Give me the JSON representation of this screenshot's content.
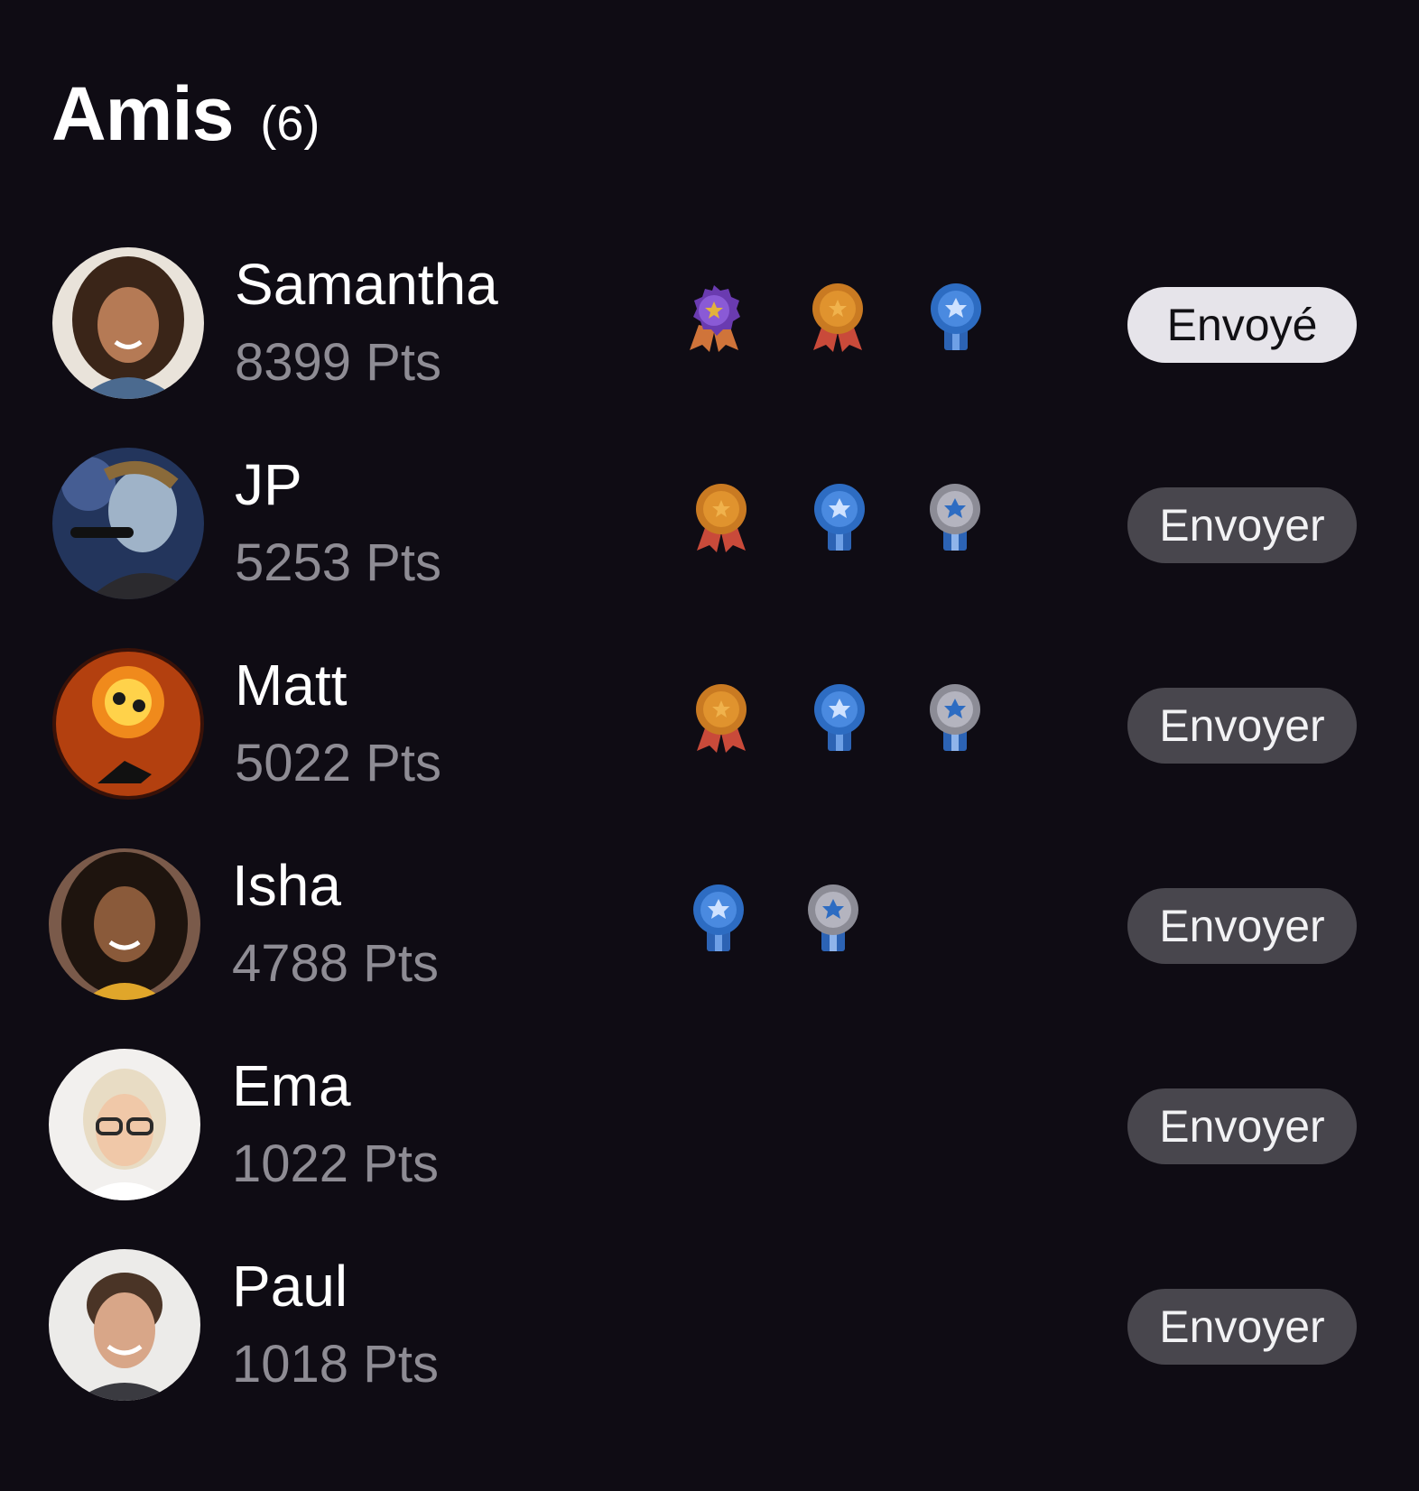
{
  "header": {
    "title": "Amis",
    "count": "(6)"
  },
  "friends": [
    {
      "name": "Samantha",
      "points": "8399 Pts",
      "button": "Envoyé",
      "sent": true,
      "badges": [
        "purple-ribbon-medal-icon",
        "bronze-ribbon-medal-icon",
        "blue-star-medal-icon"
      ]
    },
    {
      "name": "JP",
      "points": "5253 Pts",
      "button": "Envoyer",
      "sent": false,
      "badges": [
        "bronze-ribbon-medal-icon",
        "blue-star-medal-icon",
        "silver-star-medal-icon"
      ]
    },
    {
      "name": "Matt",
      "points": "5022 Pts",
      "button": "Envoyer",
      "sent": false,
      "badges": [
        "bronze-ribbon-medal-icon",
        "blue-star-medal-icon",
        "silver-star-medal-icon"
      ]
    },
    {
      "name": "Isha",
      "points": "4788 Pts",
      "button": "Envoyer",
      "sent": false,
      "badges": [
        "blue-star-medal-icon",
        "silver-star-medal-icon"
      ]
    },
    {
      "name": "Ema",
      "points": "1022 Pts",
      "button": "Envoyer",
      "sent": false,
      "badges": []
    },
    {
      "name": "Paul",
      "points": "1018 Pts",
      "button": "Envoyer",
      "sent": false,
      "badges": []
    }
  ],
  "colors": {
    "background": "#0f0c14",
    "button": "#48464d",
    "button_sent": "#e6e4ea",
    "points_text": "#8e8c94"
  }
}
